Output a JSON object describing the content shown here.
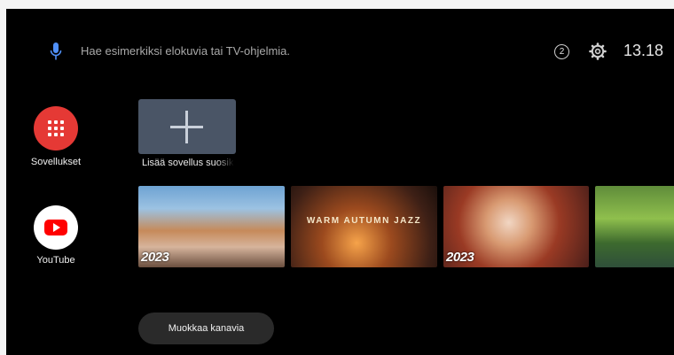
{
  "top_bar": {
    "search_hint": "Hae esimerkiksi elokuvia tai TV-ohjelmia.",
    "notification_count": "2",
    "clock": "13.18"
  },
  "left_rail": {
    "apps_label": "Sovellukset",
    "youtube_label": "YouTube"
  },
  "favorites": {
    "add_app_label": "Lisää sovellus suosikkeihin"
  },
  "channel_row": {
    "cards": [
      {
        "badge": "2023"
      },
      {
        "title": "WARM AUTUMN JAZZ"
      },
      {
        "badge": "2023"
      },
      {}
    ]
  },
  "edit_channels_label": "Muokkaa kanavia",
  "colors": {
    "apps_accent": "#e53935",
    "youtube_red": "#ff0000",
    "background": "#000000"
  }
}
